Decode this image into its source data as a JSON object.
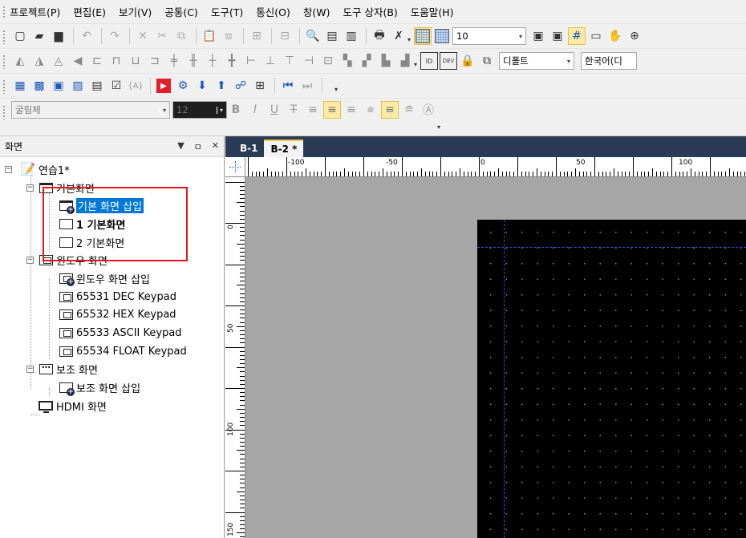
{
  "menu": [
    {
      "text": "프로젝트",
      "acc": "(P)"
    },
    {
      "text": "편집",
      "acc": "(E)"
    },
    {
      "text": "보기",
      "acc": "(V)"
    },
    {
      "text": "공통",
      "acc": "(C)"
    },
    {
      "text": "도구",
      "acc": "(T)"
    },
    {
      "text": "통신",
      "acc": "(O)"
    },
    {
      "text": "창",
      "acc": "(W)"
    },
    {
      "text": "도구 상자",
      "acc": "(B)"
    },
    {
      "text": "도움말",
      "acc": "(H)"
    }
  ],
  "toolbar1": {
    "zoom_value": "10"
  },
  "toolbar2": {
    "style_combo": "디폴트",
    "language_combo": "한국어(디"
  },
  "toolbar4": {
    "font_combo": "굴림체",
    "size_combo": "12"
  },
  "panel": {
    "title": "화면",
    "pin": "ㅁ",
    "close": "✕",
    "dropdown": "▼"
  },
  "tree": {
    "project": "연습1*",
    "basic_group": "기본화면",
    "basic_insert": "기본 화면 삽입",
    "basic_1": "1 기본화면",
    "basic_2": "2 기본화면",
    "window_group": "윈도우 화면",
    "window_insert": "윈도우 화면 삽입",
    "window_items": [
      "65531 DEC Keypad",
      "65532 HEX Keypad",
      "65533 ASCII Keypad",
      "65534 FLOAT Keypad"
    ],
    "aux_group": "보조 화면",
    "aux_insert": "보조 화면 삽입",
    "hdmi": "HDMI 화면"
  },
  "tabs": [
    "B-1",
    "B-2 *"
  ],
  "ruler": {
    "top_labels": [
      "-100",
      "-50",
      "0",
      "50",
      "100"
    ],
    "left_labels": [
      "0",
      "50",
      "100",
      "150"
    ]
  },
  "colors": {
    "tab_strip": "#2b3a55",
    "selection": "#0078d7",
    "highlight_rect": "#e8141b",
    "canvas": "#000000",
    "guide": "#3552e0"
  }
}
